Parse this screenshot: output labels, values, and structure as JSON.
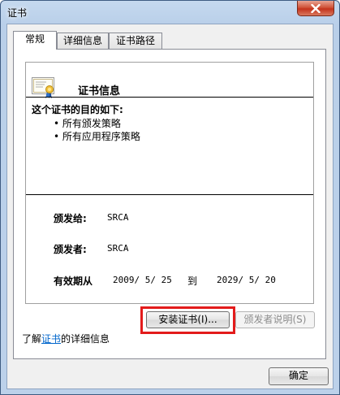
{
  "window": {
    "title": "证书",
    "close_icon": "close-icon"
  },
  "tabs": [
    {
      "label": "常规",
      "active": true
    },
    {
      "label": "详细信息",
      "active": false
    },
    {
      "label": "证书路径",
      "active": false
    }
  ],
  "general": {
    "icon": "certificate-icon",
    "title": "证书信息",
    "purpose_heading": "这个证书的目的如下:",
    "purposes": [
      "所有颁发策略",
      "所有应用程序策略"
    ],
    "issued_to_label": "颁发给:",
    "issued_to_value": "SRCA",
    "issued_by_label": "颁发者:",
    "issued_by_value": "SRCA",
    "valid_label": "有效期从",
    "valid_from": "2009/ 5/ 25",
    "valid_to_word": "到",
    "valid_to": "2029/ 5/ 20"
  },
  "buttons": {
    "install": "安装证书(I)...",
    "issuer_statement": "颁发者说明(S)",
    "ok": "确定"
  },
  "learn_more": {
    "prefix": "了解",
    "link": "证书",
    "suffix": "的详细信息"
  },
  "colors": {
    "highlight": "#e31b1b",
    "link": "#0066cc"
  }
}
